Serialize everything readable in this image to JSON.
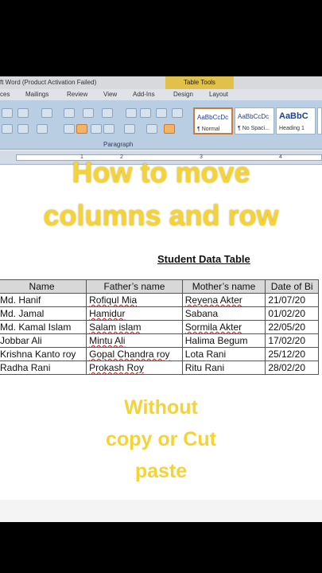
{
  "window": {
    "title": "ft Word (Product Activation Failed)",
    "context_tab_group": "Table Tools"
  },
  "ribbon_tabs": [
    "ces",
    "Mailings",
    "Review",
    "View",
    "Add-Ins",
    "Design",
    "Layout"
  ],
  "ribbon": {
    "group_label": "Paragraph",
    "styles": [
      {
        "sample": "AaBbCcDc",
        "name": "¶ Normal"
      },
      {
        "sample": "AaBbCcDc",
        "name": "¶ No Spaci..."
      },
      {
        "sample": "AaBbC",
        "name": "Heading 1"
      }
    ]
  },
  "ruler": {
    "numbers": [
      "1",
      "2",
      "3",
      "4"
    ]
  },
  "document": {
    "title": "Student Data Table",
    "table": {
      "headers": [
        "Name",
        "Father’s name",
        "Mother’s name",
        "Date of Bi"
      ],
      "rows": [
        [
          "Md. Hanif",
          "Rofiqul Mia",
          "Reyena Akter",
          "21/07/20"
        ],
        [
          "Md. Jamal",
          "Hamidur",
          "Sabana",
          "01/02/20"
        ],
        [
          "Md. Kamal Islam",
          "Salam islam",
          "Sormila Akter",
          "22/05/20"
        ],
        [
          "Jobbar Ali",
          "Mintu Ali",
          "Halima Begum",
          "17/02/20"
        ],
        [
          "Krishna Kanto roy",
          "Gopal Chandra roy",
          "Lota Rani",
          "25/12/20"
        ],
        [
          "Radha Rani",
          "Prokash Roy",
          "Ritu Rani",
          "28/02/20"
        ]
      ]
    }
  },
  "overlay": {
    "line1": "How to move",
    "line2": "columns and row",
    "line3": "Without",
    "line4": "copy or Cut",
    "line5": "paste"
  },
  "taskbar": {
    "icons": [
      "task-view-icon",
      "file-explorer-icon",
      "chrome-icon",
      "vscode-icon",
      "whatsapp-icon",
      "word-icon",
      "excel-icon",
      "powerpoint-icon",
      "media-player-icon",
      "photos-icon",
      "steam-icon"
    ]
  },
  "colors": {
    "overlay_text": "#f5d335",
    "ribbon": "#b9cde3",
    "table_tools": "#e2c14a"
  }
}
